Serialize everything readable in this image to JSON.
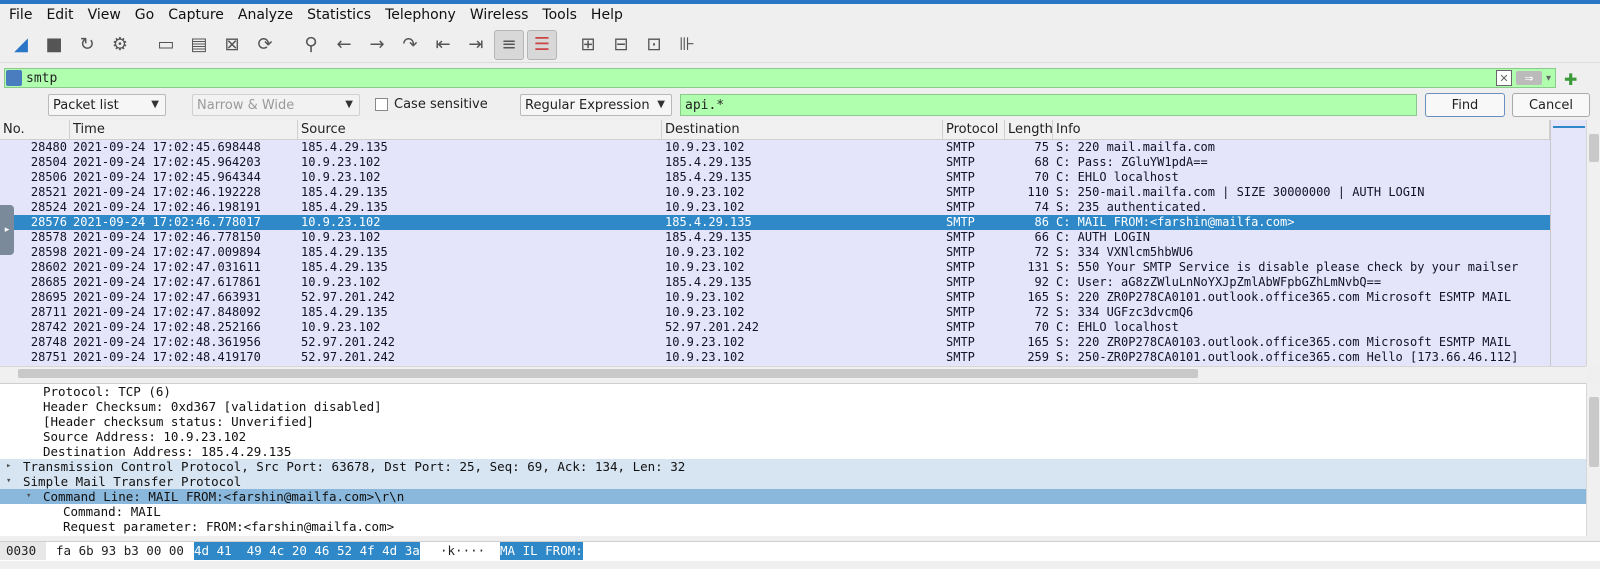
{
  "menubar": [
    "File",
    "Edit",
    "View",
    "Go",
    "Capture",
    "Analyze",
    "Statistics",
    "Telephony",
    "Wireless",
    "Tools",
    "Help"
  ],
  "toolbar_icons": [
    "shark-fin-icon",
    "stop-icon",
    "restart-icon",
    "options-gear-icon",
    "open-folder-icon",
    "file-icon",
    "close-file-icon",
    "reload-icon",
    "search-icon",
    "back-arrow-icon",
    "forward-arrow-icon",
    "go-to-packet-icon",
    "first-packet-icon",
    "last-packet-icon",
    "autoscroll-icon",
    "colorize-icon",
    "zoom-in-icon",
    "zoom-out-icon",
    "normal-size-icon",
    "resize-columns-icon"
  ],
  "display_filter": {
    "value": "smtp"
  },
  "find": {
    "search_in": "Packet list",
    "char_width": "Narrow & Wide",
    "case_sensitive_label": "Case sensitive",
    "search_type": "Regular Expression",
    "value": "api.*",
    "find_label": "Find",
    "cancel_label": "Cancel"
  },
  "packet_list": {
    "columns": [
      "No.",
      "Time",
      "Source",
      "Destination",
      "Protocol",
      "Length",
      "Info"
    ],
    "rows": [
      {
        "no": "28480",
        "time": "2021-09-24 17:02:45.698448",
        "src": "185.4.29.135",
        "dst": "10.9.23.102",
        "proto": "SMTP",
        "len": "75",
        "info": "S: 220 mail.mailfa.com"
      },
      {
        "no": "28504",
        "time": "2021-09-24 17:02:45.964203",
        "src": "10.9.23.102",
        "dst": "185.4.29.135",
        "proto": "SMTP",
        "len": "68",
        "info": "C: Pass: ZGluYW1pdA=="
      },
      {
        "no": "28506",
        "time": "2021-09-24 17:02:45.964344",
        "src": "10.9.23.102",
        "dst": "185.4.29.135",
        "proto": "SMTP",
        "len": "70",
        "info": "C: EHLO localhost"
      },
      {
        "no": "28521",
        "time": "2021-09-24 17:02:46.192228",
        "src": "185.4.29.135",
        "dst": "10.9.23.102",
        "proto": "SMTP",
        "len": "110",
        "info": "S: 250-mail.mailfa.com | SIZE 30000000 | AUTH LOGIN"
      },
      {
        "no": "28524",
        "time": "2021-09-24 17:02:46.198191",
        "src": "185.4.29.135",
        "dst": "10.9.23.102",
        "proto": "SMTP",
        "len": "74",
        "info": "S: 235 authenticated."
      },
      {
        "no": "28576",
        "time": "2021-09-24 17:02:46.778017",
        "src": "10.9.23.102",
        "dst": "185.4.29.135",
        "proto": "SMTP",
        "len": "86",
        "info": "C: MAIL FROM:<farshin@mailfa.com>",
        "selected": true
      },
      {
        "no": "28578",
        "time": "2021-09-24 17:02:46.778150",
        "src": "10.9.23.102",
        "dst": "185.4.29.135",
        "proto": "SMTP",
        "len": "66",
        "info": "C: AUTH LOGIN"
      },
      {
        "no": "28598",
        "time": "2021-09-24 17:02:47.009894",
        "src": "185.4.29.135",
        "dst": "10.9.23.102",
        "proto": "SMTP",
        "len": "72",
        "info": "S: 334 VXNlcm5hbWU6"
      },
      {
        "no": "28602",
        "time": "2021-09-24 17:02:47.031611",
        "src": "185.4.29.135",
        "dst": "10.9.23.102",
        "proto": "SMTP",
        "len": "131",
        "info": "S: 550 Your SMTP Service is disable please check by your mailser"
      },
      {
        "no": "28685",
        "time": "2021-09-24 17:02:47.617861",
        "src": "10.9.23.102",
        "dst": "185.4.29.135",
        "proto": "SMTP",
        "len": "92",
        "info": "C: User: aG8zZWluLnNoYXJpZmlAbWFpbGZhLmNvbQ=="
      },
      {
        "no": "28695",
        "time": "2021-09-24 17:02:47.663931",
        "src": "52.97.201.242",
        "dst": "10.9.23.102",
        "proto": "SMTP",
        "len": "165",
        "info": "S: 220 ZR0P278CA0101.outlook.office365.com Microsoft ESMTP MAIL"
      },
      {
        "no": "28711",
        "time": "2021-09-24 17:02:47.848092",
        "src": "185.4.29.135",
        "dst": "10.9.23.102",
        "proto": "SMTP",
        "len": "72",
        "info": "S: 334 UGFzc3dvcmQ6"
      },
      {
        "no": "28742",
        "time": "2021-09-24 17:02:48.252166",
        "src": "10.9.23.102",
        "dst": "52.97.201.242",
        "proto": "SMTP",
        "len": "70",
        "info": "C: EHLO localhost"
      },
      {
        "no": "28748",
        "time": "2021-09-24 17:02:48.361956",
        "src": "52.97.201.242",
        "dst": "10.9.23.102",
        "proto": "SMTP",
        "len": "165",
        "info": "S: 220 ZR0P278CA0103.outlook.office365.com Microsoft ESMTP MAIL"
      },
      {
        "no": "28751",
        "time": "2021-09-24 17:02:48.419170",
        "src": "52.97.201.242",
        "dst": "10.9.23.102",
        "proto": "SMTP",
        "len": "259",
        "info": "S: 250-ZR0P278CA0101.outlook.office365.com Hello [173.66.46.112]"
      }
    ]
  },
  "details": [
    {
      "text": "Protocol: TCP (6)",
      "indent": 2,
      "tw": ""
    },
    {
      "text": "Header Checksum: 0xd367 [validation disabled]",
      "indent": 2,
      "tw": ""
    },
    {
      "text": "[Header checksum status: Unverified]",
      "indent": 2,
      "tw": ""
    },
    {
      "text": "Source Address: 10.9.23.102",
      "indent": 2,
      "tw": ""
    },
    {
      "text": "Destination Address: 185.4.29.135",
      "indent": 2,
      "tw": ""
    },
    {
      "text": "Transmission Control Protocol, Src Port: 63678, Dst Port: 25, Seq: 69, Ack: 134, Len: 32",
      "indent": 1,
      "tw": "▸",
      "style": "hl"
    },
    {
      "text": "Simple Mail Transfer Protocol",
      "indent": 1,
      "tw": "▾",
      "style": "hl"
    },
    {
      "text": "Command Line: MAIL FROM:<farshin@mailfa.com>\\r\\n",
      "indent": 2,
      "tw": "▾",
      "style": "sel"
    },
    {
      "text": "Command: MAIL",
      "indent": 3,
      "tw": ""
    },
    {
      "text": "Request parameter: FROM:<farshin@mailfa.com>",
      "indent": 3,
      "tw": ""
    }
  ],
  "bytes": {
    "offset": "0030",
    "hex_plain": "fa 6b 93 b3 00 00",
    "hex_sel": "4d 41  49 4c 20 46 52 4f 4d 3a",
    "ascii_plain": "·k····",
    "ascii_sel": "MA IL FROM:"
  }
}
